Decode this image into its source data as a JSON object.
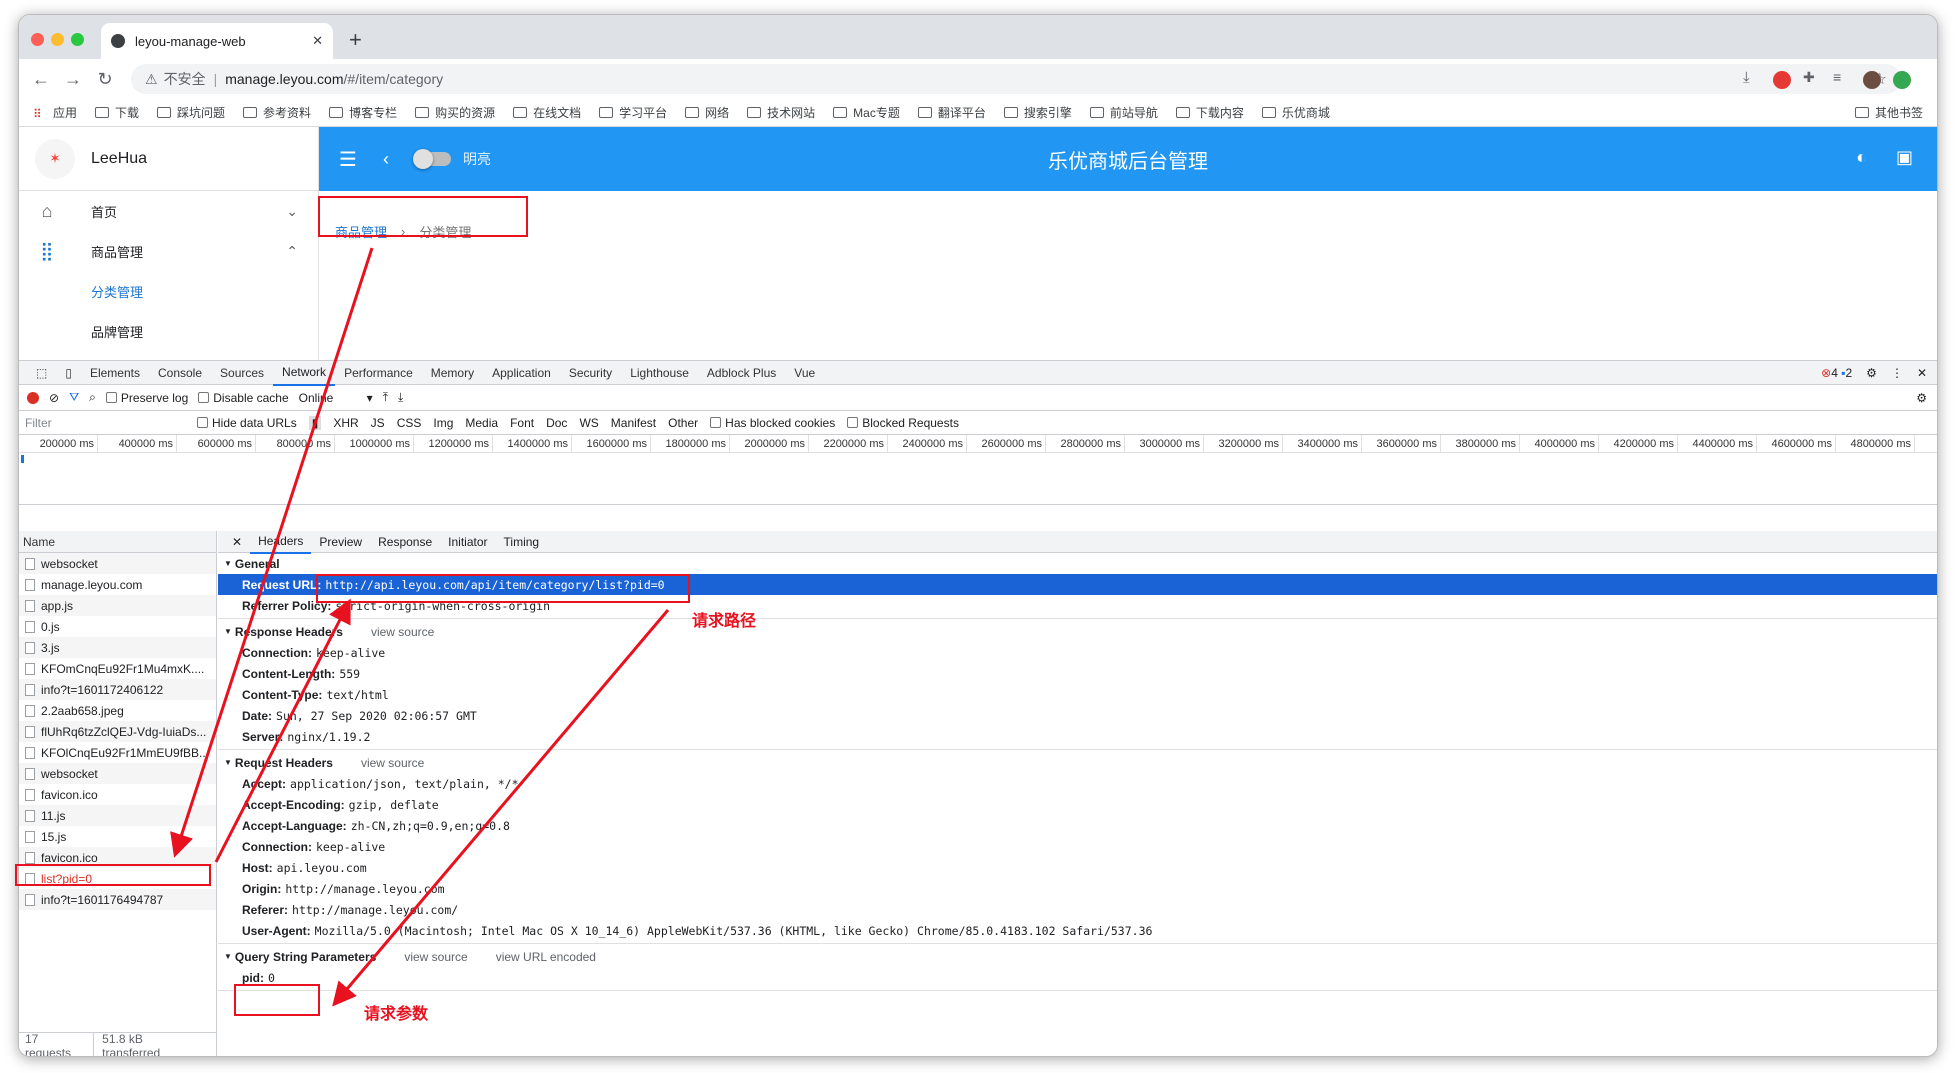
{
  "browser": {
    "tab_title": "leyou-manage-web",
    "insecure_label": "不安全",
    "url_host": "manage.leyou.com",
    "url_path": "/#/item/category"
  },
  "bookmarks": [
    "应用",
    "下载",
    "踩坑问题",
    "参考资料",
    "博客专栏",
    "购买的资源",
    "在线文档",
    "学习平台",
    "网络",
    "技术网站",
    "Mac专题",
    "翻译平台",
    "搜索引擎",
    "前站导航",
    "下载内容",
    "乐优商城"
  ],
  "bookmarks_other": "其他书签",
  "app": {
    "user": "LeeHua",
    "menu": {
      "home": "首页",
      "goods": "商品管理",
      "category": "分类管理",
      "brand": "品牌管理"
    },
    "mode_label": "明亮",
    "title": "乐优商城后台管理",
    "breadcrumb": {
      "first": "商品管理",
      "second": "分类管理"
    }
  },
  "devtools": {
    "tabs": [
      "Elements",
      "Console",
      "Sources",
      "Network",
      "Performance",
      "Memory",
      "Application",
      "Security",
      "Lighthouse",
      "Adblock Plus",
      "Vue"
    ],
    "issue_counts": {
      "errors": "4",
      "messages": "2"
    },
    "preserve_log": "Preserve log",
    "disable_cache": "Disable cache",
    "throttle": "Online",
    "filter_placeholder": "Filter",
    "hide_data_urls": "Hide data URLs",
    "types": [
      "XHR",
      "JS",
      "CSS",
      "Img",
      "Media",
      "Font",
      "Doc",
      "WS",
      "Manifest",
      "Other"
    ],
    "has_blocked_cookies": "Has blocked cookies",
    "blocked_requests": "Blocked Requests",
    "timeline_ticks": [
      "200000 ms",
      "400000 ms",
      "600000 ms",
      "800000 ms",
      "1000000 ms",
      "1200000 ms",
      "1400000 ms",
      "1600000 ms",
      "1800000 ms",
      "2000000 ms",
      "2200000 ms",
      "2400000 ms",
      "2600000 ms",
      "2800000 ms",
      "3000000 ms",
      "3200000 ms",
      "3400000 ms",
      "3600000 ms",
      "3800000 ms",
      "4000000 ms",
      "4200000 ms",
      "4400000 ms",
      "4600000 ms",
      "4800000 ms",
      "50"
    ],
    "name_header": "Name",
    "requests": [
      "websocket",
      "manage.leyou.com",
      "app.js",
      "0.js",
      "3.js",
      "KFOmCnqEu92Fr1Mu4mxK....",
      "info?t=1601172406122",
      "2.2aab658.jpeg",
      "flUhRq6tzZclQEJ-Vdg-IuiaDs...",
      "KFOlCnqEu92Fr1MmEU9fBB...",
      "websocket",
      "favicon.ico",
      "11.js",
      "15.js",
      "favicon.ico",
      "list?pid=0",
      "info?t=1601176494787"
    ],
    "footer": {
      "requests": "17 requests",
      "transferred": "51.8 kB transferred"
    },
    "detail_tabs": [
      "Headers",
      "Preview",
      "Response",
      "Initiator",
      "Timing"
    ],
    "general": {
      "title": "General",
      "request_url_key": "Request URL:",
      "request_url": "http://api.leyou.com/api/item/category/list?pid=0",
      "referrer_policy_key": "Referrer Policy:",
      "referrer_policy": "strict-origin-when-cross-origin"
    },
    "view_source": "view source",
    "view_url_encoded": "view URL encoded",
    "response_headers_title": "Response Headers",
    "response_headers": [
      {
        "k": "Connection:",
        "v": "keep-alive"
      },
      {
        "k": "Content-Length:",
        "v": "559"
      },
      {
        "k": "Content-Type:",
        "v": "text/html"
      },
      {
        "k": "Date:",
        "v": "Sun, 27 Sep 2020 02:06:57 GMT"
      },
      {
        "k": "Server:",
        "v": "nginx/1.19.2"
      }
    ],
    "request_headers_title": "Request Headers",
    "request_headers": [
      {
        "k": "Accept:",
        "v": "application/json, text/plain, */*"
      },
      {
        "k": "Accept-Encoding:",
        "v": "gzip, deflate"
      },
      {
        "k": "Accept-Language:",
        "v": "zh-CN,zh;q=0.9,en;q=0.8"
      },
      {
        "k": "Connection:",
        "v": "keep-alive"
      },
      {
        "k": "Host:",
        "v": "api.leyou.com"
      },
      {
        "k": "Origin:",
        "v": "http://manage.leyou.com"
      },
      {
        "k": "Referer:",
        "v": "http://manage.leyou.com/"
      },
      {
        "k": "User-Agent:",
        "v": "Mozilla/5.0 (Macintosh; Intel Mac OS X 10_14_6) AppleWebKit/537.36 (KHTML, like Gecko) Chrome/85.0.4183.102 Safari/537.36"
      }
    ],
    "query_title": "Query String Parameters",
    "query": {
      "k": "pid:",
      "v": "0"
    }
  },
  "annotations": {
    "path_label": "请求路径",
    "param_label": "请求参数"
  },
  "colors": {
    "appbar": "#2196f3",
    "annotation": "#e8111f",
    "highlight": "#1a63d6"
  }
}
